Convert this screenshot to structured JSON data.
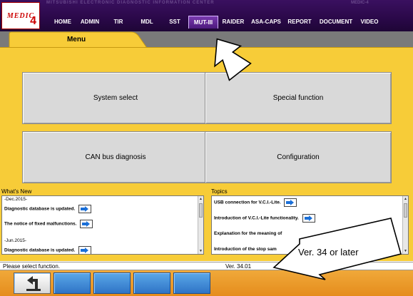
{
  "topbar": {
    "faint_left": "MITSUBISHI ELECTRONIC DIAGNOSTIC INFORMATION CENTER",
    "faint_right": "MEDIC-4",
    "logo_text": "MEDIC",
    "logo_number": "4"
  },
  "nav": [
    {
      "label": "HOME",
      "active": false
    },
    {
      "label": "ADMIN",
      "active": false
    },
    {
      "label": "TIR",
      "active": false
    },
    {
      "label": "MDL",
      "active": false
    },
    {
      "label": "SST",
      "active": false
    },
    {
      "label": "MUT-III",
      "active": true
    },
    {
      "label": "RAIDER",
      "active": false
    },
    {
      "label": "ASA-CAPS",
      "active": false
    },
    {
      "label": "REPORT",
      "active": false
    },
    {
      "label": "DOCUMENT",
      "active": false
    },
    {
      "label": "VIDEO",
      "active": false
    }
  ],
  "tab": {
    "label": "Menu"
  },
  "buttons": {
    "system_select": "System select",
    "special_function": "Special function",
    "can_bus": "CAN bus diagnosis",
    "configuration": "Configuration"
  },
  "whats_new": {
    "title": "What's New",
    "date1": "-Dec.2015-",
    "item1": "Diagnostic database is updated.",
    "item2": "The notice of fixed malfunctions.",
    "date2": "-Jun.2015-",
    "item3": "Diagnostic database is updated."
  },
  "topics": {
    "title": "Topics",
    "item1": "USB connection for V.C.I.-Lite.",
    "item2": "Introduction of V.C.I.-Lite functionality.",
    "item3": "Explanation for the meaning of",
    "item4": "Introduction of the stop sam"
  },
  "status": {
    "message": "Please select function.",
    "version": "Ver. 34.01"
  },
  "callout": {
    "version_note": "Ver. 34 or later"
  },
  "colors": {
    "panel": "#f7cc38",
    "topbar": "#2a0848",
    "bottombar": "#e58c1c",
    "tool_button": "#2f74c6",
    "arrow_blue": "#1a6fd8"
  },
  "icons": {
    "back": "back-arrow-icon",
    "list_arrow": "blue-right-arrow-icon"
  }
}
